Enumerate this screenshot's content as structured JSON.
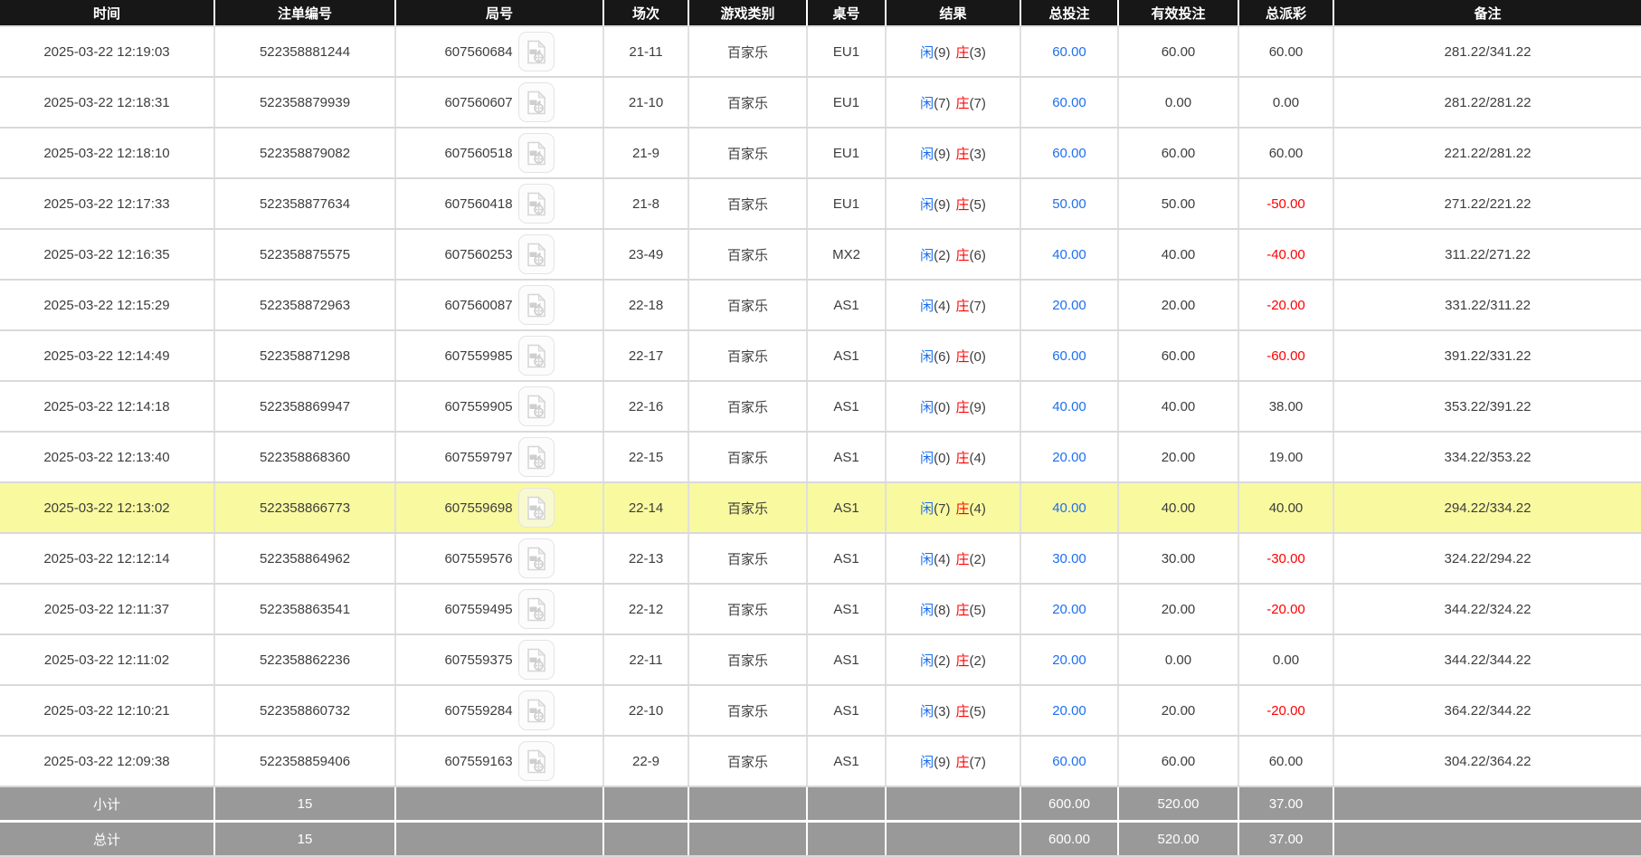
{
  "colors": {
    "header_bg": "#171717",
    "header_text": "#ffffff",
    "body_text": "#3d3d3d",
    "bet_blue": "#1e6ff0",
    "loss_red": "#ff0000",
    "player_blue": "#1e6ff0",
    "banker_red": "#ff0000",
    "footer_bg": "#999999",
    "highlight_yellow": "#f9f9a0",
    "row_border": "#d9d9d9"
  },
  "table": {
    "headers": [
      "时间",
      "注单编号",
      "局号",
      "场次",
      "游戏类别",
      "桌号",
      "结果",
      "总投注",
      "有效投注",
      "总派彩",
      "备注"
    ],
    "result_labels": {
      "player": "闲",
      "banker": "庄"
    },
    "icons": {
      "round_replay": "video-file-icon"
    },
    "rows": [
      {
        "time": "2025-03-22 12:19:03",
        "bet_no": "522358881244",
        "round_no": "607560684",
        "session": "21-11",
        "game_type": "百家乐",
        "table_no": "EU1",
        "player_score": "(9)",
        "banker_score": "(3)",
        "total_bet": "60.00",
        "valid_bet": "60.00",
        "payout": "60.00",
        "remark": "281.22/341.22",
        "highlighted": false
      },
      {
        "time": "2025-03-22 12:18:31",
        "bet_no": "522358879939",
        "round_no": "607560607",
        "session": "21-10",
        "game_type": "百家乐",
        "table_no": "EU1",
        "player_score": "(7)",
        "banker_score": "(7)",
        "total_bet": "60.00",
        "valid_bet": "0.00",
        "payout": "0.00",
        "remark": "281.22/281.22",
        "highlighted": false
      },
      {
        "time": "2025-03-22 12:18:10",
        "bet_no": "522358879082",
        "round_no": "607560518",
        "session": "21-9",
        "game_type": "百家乐",
        "table_no": "EU1",
        "player_score": "(9)",
        "banker_score": "(3)",
        "total_bet": "60.00",
        "valid_bet": "60.00",
        "payout": "60.00",
        "remark": "221.22/281.22",
        "highlighted": false
      },
      {
        "time": "2025-03-22 12:17:33",
        "bet_no": "522358877634",
        "round_no": "607560418",
        "session": "21-8",
        "game_type": "百家乐",
        "table_no": "EU1",
        "player_score": "(9)",
        "banker_score": "(5)",
        "total_bet": "50.00",
        "valid_bet": "50.00",
        "payout": "-50.00",
        "remark": "271.22/221.22",
        "highlighted": false
      },
      {
        "time": "2025-03-22 12:16:35",
        "bet_no": "522358875575",
        "round_no": "607560253",
        "session": "23-49",
        "game_type": "百家乐",
        "table_no": "MX2",
        "player_score": "(2)",
        "banker_score": "(6)",
        "total_bet": "40.00",
        "valid_bet": "40.00",
        "payout": "-40.00",
        "remark": "311.22/271.22",
        "highlighted": false
      },
      {
        "time": "2025-03-22 12:15:29",
        "bet_no": "522358872963",
        "round_no": "607560087",
        "session": "22-18",
        "game_type": "百家乐",
        "table_no": "AS1",
        "player_score": "(4)",
        "banker_score": "(7)",
        "total_bet": "20.00",
        "valid_bet": "20.00",
        "payout": "-20.00",
        "remark": "331.22/311.22",
        "highlighted": false
      },
      {
        "time": "2025-03-22 12:14:49",
        "bet_no": "522358871298",
        "round_no": "607559985",
        "session": "22-17",
        "game_type": "百家乐",
        "table_no": "AS1",
        "player_score": "(6)",
        "banker_score": "(0)",
        "total_bet": "60.00",
        "valid_bet": "60.00",
        "payout": "-60.00",
        "remark": "391.22/331.22",
        "highlighted": false
      },
      {
        "time": "2025-03-22 12:14:18",
        "bet_no": "522358869947",
        "round_no": "607559905",
        "session": "22-16",
        "game_type": "百家乐",
        "table_no": "AS1",
        "player_score": "(0)",
        "banker_score": "(9)",
        "total_bet": "40.00",
        "valid_bet": "40.00",
        "payout": "38.00",
        "remark": "353.22/391.22",
        "highlighted": false
      },
      {
        "time": "2025-03-22 12:13:40",
        "bet_no": "522358868360",
        "round_no": "607559797",
        "session": "22-15",
        "game_type": "百家乐",
        "table_no": "AS1",
        "player_score": "(0)",
        "banker_score": "(4)",
        "total_bet": "20.00",
        "valid_bet": "20.00",
        "payout": "19.00",
        "remark": "334.22/353.22",
        "highlighted": false
      },
      {
        "time": "2025-03-22 12:13:02",
        "bet_no": "522358866773",
        "round_no": "607559698",
        "session": "22-14",
        "game_type": "百家乐",
        "table_no": "AS1",
        "player_score": "(7)",
        "banker_score": "(4)",
        "total_bet": "40.00",
        "valid_bet": "40.00",
        "payout": "40.00",
        "remark": "294.22/334.22",
        "highlighted": true
      },
      {
        "time": "2025-03-22 12:12:14",
        "bet_no": "522358864962",
        "round_no": "607559576",
        "session": "22-13",
        "game_type": "百家乐",
        "table_no": "AS1",
        "player_score": "(4)",
        "banker_score": "(2)",
        "total_bet": "30.00",
        "valid_bet": "30.00",
        "payout": "-30.00",
        "remark": "324.22/294.22",
        "highlighted": false
      },
      {
        "time": "2025-03-22 12:11:37",
        "bet_no": "522358863541",
        "round_no": "607559495",
        "session": "22-12",
        "game_type": "百家乐",
        "table_no": "AS1",
        "player_score": "(8)",
        "banker_score": "(5)",
        "total_bet": "20.00",
        "valid_bet": "20.00",
        "payout": "-20.00",
        "remark": "344.22/324.22",
        "highlighted": false
      },
      {
        "time": "2025-03-22 12:11:02",
        "bet_no": "522358862236",
        "round_no": "607559375",
        "session": "22-11",
        "game_type": "百家乐",
        "table_no": "AS1",
        "player_score": "(2)",
        "banker_score": "(2)",
        "total_bet": "20.00",
        "valid_bet": "0.00",
        "payout": "0.00",
        "remark": "344.22/344.22",
        "highlighted": false
      },
      {
        "time": "2025-03-22 12:10:21",
        "bet_no": "522358860732",
        "round_no": "607559284",
        "session": "22-10",
        "game_type": "百家乐",
        "table_no": "AS1",
        "player_score": "(3)",
        "banker_score": "(5)",
        "total_bet": "20.00",
        "valid_bet": "20.00",
        "payout": "-20.00",
        "remark": "364.22/344.22",
        "highlighted": false
      },
      {
        "time": "2025-03-22 12:09:38",
        "bet_no": "522358859406",
        "round_no": "607559163",
        "session": "22-9",
        "game_type": "百家乐",
        "table_no": "AS1",
        "player_score": "(9)",
        "banker_score": "(7)",
        "total_bet": "60.00",
        "valid_bet": "60.00",
        "payout": "60.00",
        "remark": "304.22/364.22",
        "highlighted": false
      }
    ],
    "footer": [
      {
        "label": "小计",
        "count": "15",
        "total_bet": "600.00",
        "valid_bet": "520.00",
        "payout": "37.00"
      },
      {
        "label": "总计",
        "count": "15",
        "total_bet": "600.00",
        "valid_bet": "520.00",
        "payout": "37.00"
      }
    ]
  }
}
